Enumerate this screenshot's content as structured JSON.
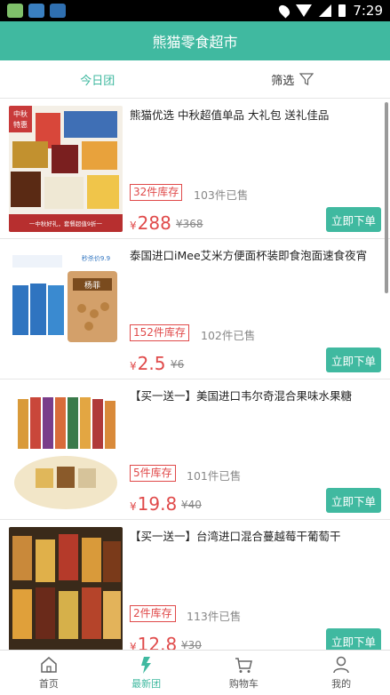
{
  "status_bar": {
    "time": "7:29"
  },
  "header": {
    "title": "熊猫零食超市"
  },
  "filters": {
    "today": "今日团",
    "filter": "筛选"
  },
  "colors": {
    "accent": "#40b9a0",
    "price": "#e04a4a"
  },
  "products": [
    {
      "name": "熊猫优选 中秋超值单品 大礼包 送礼佳品",
      "stock": "32件库存",
      "sold": "103件已售",
      "currency": "¥",
      "price": "288",
      "old_price": "¥368",
      "buy": "立即下单",
      "image_text": {
        "badge_top": "中秋",
        "badge_bottom": "特惠",
        "caption": "一中秋好礼，套餐超值9折一"
      }
    },
    {
      "name": "泰国进口iMee艾米方便面杯装即食泡面速食夜宵",
      "stock": "152件库存",
      "sold": "102件已售",
      "currency": "¥",
      "price": "2.5",
      "old_price": "¥6",
      "buy": "立即下单",
      "image_text": {
        "label_a": "秒杀价9.9",
        "label_b": "杨菲"
      }
    },
    {
      "name": "【买一送一】美国进口韦尔奇混合果味水果糖",
      "stock": "5件库存",
      "sold": "101件已售",
      "currency": "¥",
      "price": "19.8",
      "old_price": "¥40",
      "buy": "立即下单"
    },
    {
      "name": "【买一送一】台湾进口混合蔓越莓干葡萄干",
      "stock": "2件库存",
      "sold": "113件已售",
      "currency": "¥",
      "price": "12.8",
      "old_price": "¥30",
      "buy": "立即下单"
    }
  ],
  "tabs": [
    {
      "label": "首页",
      "icon": "home-icon"
    },
    {
      "label": "最新团",
      "icon": "lightning-icon"
    },
    {
      "label": "购物车",
      "icon": "cart-icon"
    },
    {
      "label": "我的",
      "icon": "user-icon"
    }
  ]
}
